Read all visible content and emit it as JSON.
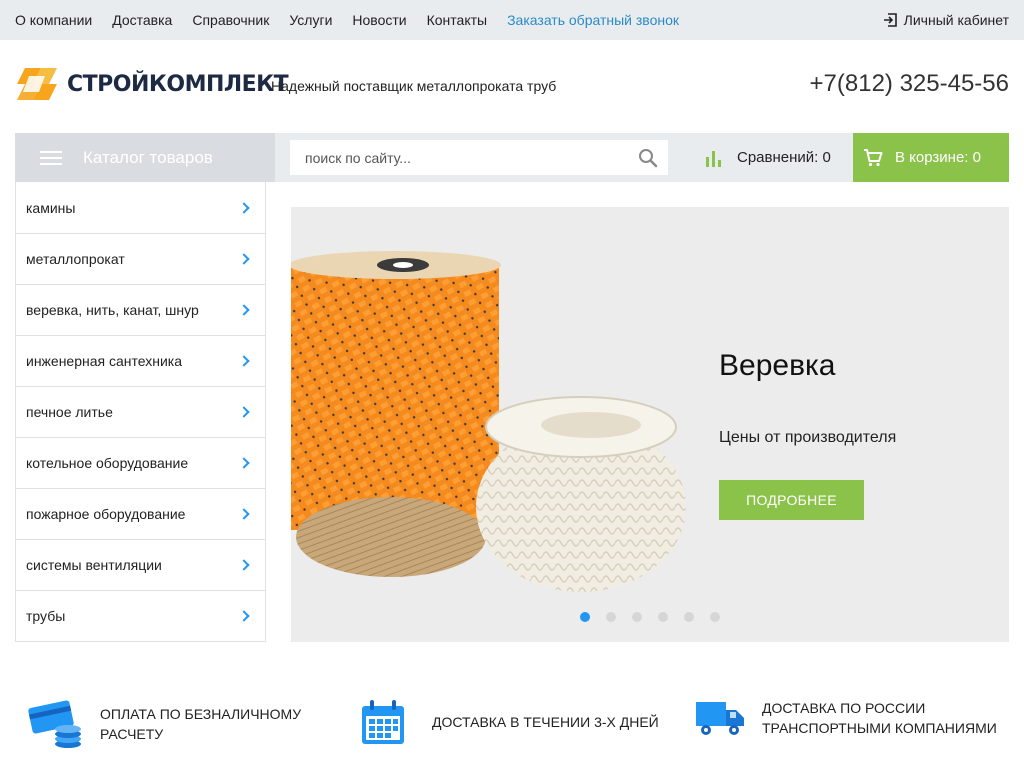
{
  "topnav": {
    "items": [
      "О компании",
      "Доставка",
      "Справочник",
      "Услуги",
      "Новости",
      "Контакты"
    ],
    "callback": "Заказать обратный звонок",
    "cabinet": "Личный кабинет"
  },
  "header": {
    "logo_text": "СТРОЙКОМПЛЕКТ",
    "tagline": "Надежный поставщик металлопроката труб",
    "phone": "+7(812) 325-45-56"
  },
  "catalog": {
    "button_label": "Каталог товаров",
    "search_placeholder": "поиск по сайту...",
    "compare_label": "Сравнений: 0",
    "cart_label": "В корзине: 0"
  },
  "sidebar": {
    "items": [
      "камины",
      "металлопрокат",
      "веревка, нить, канат, шнур",
      "инженерная сантехника",
      "печное литье",
      "котельное оборудование",
      "пожарное оборудование",
      "системы вентиляции",
      "трубы"
    ]
  },
  "banner": {
    "title": "Веревка",
    "subtitle": "Цены от производителя",
    "button": "ПОДРОБНЕЕ",
    "active_slide": 1,
    "slides_count": 6
  },
  "features": [
    {
      "line1": "ОПЛАТА ПО БЕЗНАЛИЧНОМУ",
      "line2": "РАСЧЕТУ",
      "icon": "card-coins-icon"
    },
    {
      "line1": "ДОСТАВКА В ТЕЧЕНИИ 3-Х ДНЕЙ",
      "line2": "",
      "icon": "calendar-icon"
    },
    {
      "line1": "ДОСТАВКА ПО РОССИИ",
      "line2": "ТРАНСПОРТНЫМИ КОМПАНИЯМИ",
      "icon": "truck-icon"
    }
  ],
  "colors": {
    "accent_green": "#8bc34a",
    "accent_blue": "#2196f3",
    "logo_orange": "#f7a51c"
  }
}
